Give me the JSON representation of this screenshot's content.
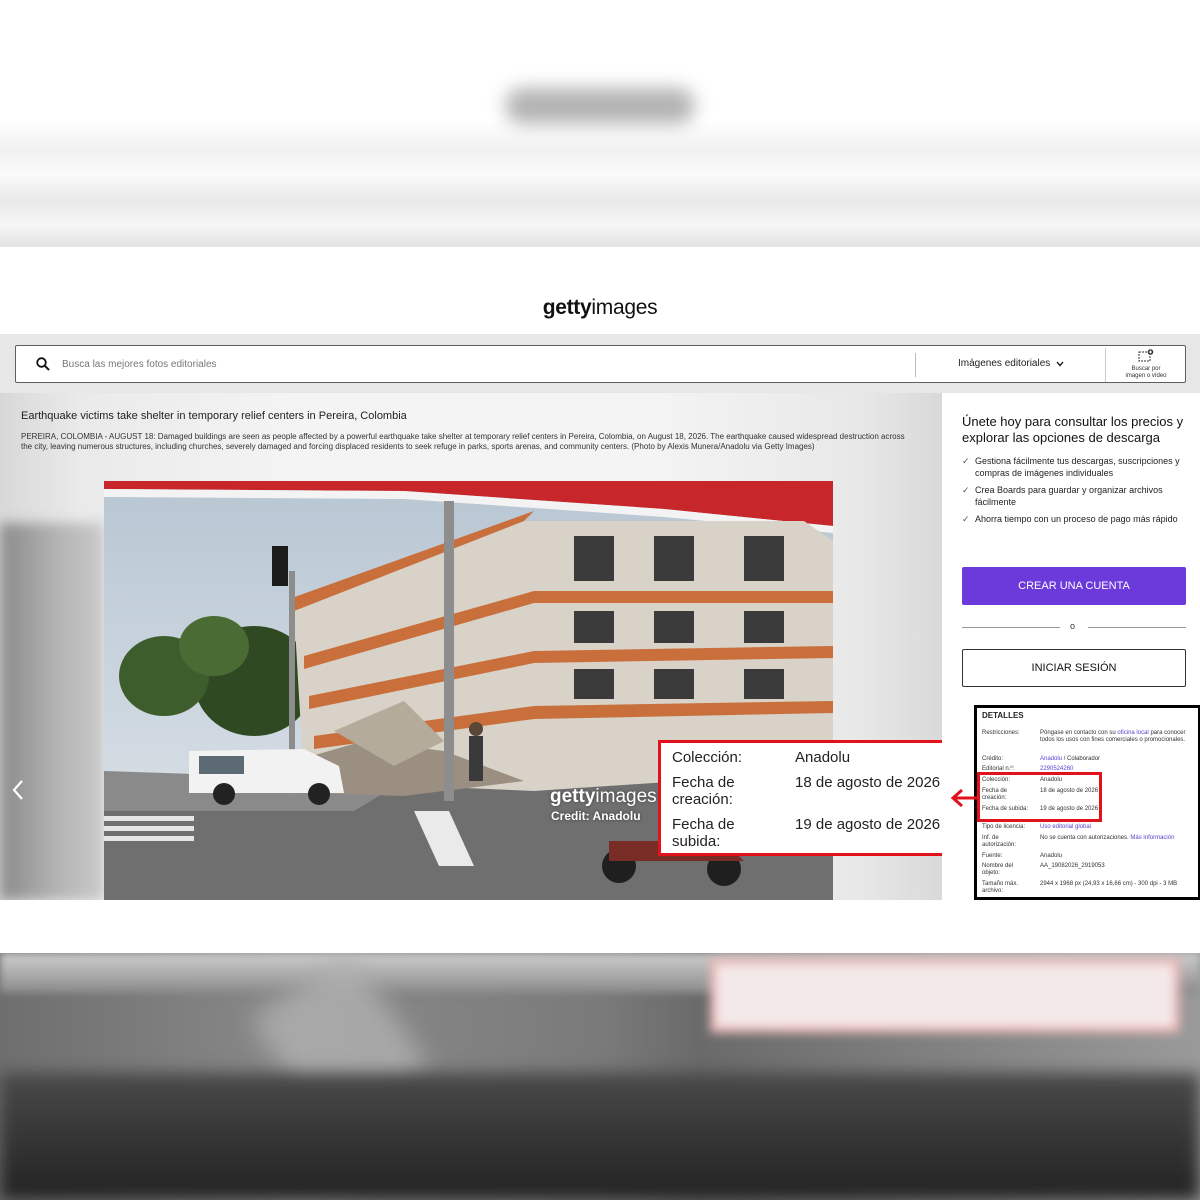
{
  "brand": {
    "logo_bold": "getty",
    "logo_light": "images"
  },
  "search": {
    "placeholder": "Busca las mejores fotos editoriales",
    "type_label": "Imágenes editoriales",
    "visual_search_label_1": "Buscar por",
    "visual_search_label_2": "imagen o vídeo"
  },
  "photo": {
    "title": "Earthquake victims take shelter in temporary relief centers in Pereira, Colombia",
    "caption": "PEREIRA, COLOMBIA - AUGUST 18: Damaged buildings are seen as people affected by a powerful earthquake take shelter at temporary relief centers in Pereira, Colombia, on August 18, 2026. The earthquake caused widespread destruction across the city, leaving numerous structures, including churches, severely damaged and forcing displaced residents to seek refuge in parks, sports arenas, and community centers. (Photo by Alexis Munera/Anadolu via Getty Images)",
    "watermark_bold": "getty",
    "watermark_light": "images",
    "credit": "Credit: Anadolu"
  },
  "highlight": {
    "rows": [
      {
        "label": "Colección:",
        "value": "Anadolu"
      },
      {
        "label": "Fecha de creación:",
        "value": "18 de agosto de 2026"
      },
      {
        "label": "Fecha de subida:",
        "value": "19 de agosto de 2026"
      }
    ]
  },
  "panel": {
    "title": "Únete hoy para consultar los precios y explorar las opciones de descarga",
    "benefits": [
      "Gestiona fácilmente tus descargas, suscripciones y compras de imágenes individuales",
      "Crea Boards para guardar y organizar archivos fácilmente",
      "Ahorra tiempo con un proceso de pago más rápido"
    ],
    "create_account": "CREAR UNA CUENTA",
    "or": "o",
    "login": "INICIAR SESIÓN"
  },
  "details": {
    "title": "DETALLES",
    "restrictions_label": "Restricciones:",
    "restrictions_value_1": "Póngase en contacto con su",
    "restrictions_link": "oficina local",
    "restrictions_value_2": "para conocer todos los usos con fines comerciales o promocionales.",
    "credit_label": "Crédito:",
    "credit_link": "Anadolu",
    "credit_rest": "/ Colaborador",
    "editorial_label": "Editorial n.º:",
    "editorial_value": "2290524260",
    "collection_label": "Colección:",
    "collection_value": "Anadolu",
    "created_label": "Fecha de creación:",
    "created_value": "18 de agosto de 2026",
    "uploaded_label": "Fecha de subida:",
    "uploaded_value": "19 de agosto de 2026",
    "license_label": "Tipo de licencia:",
    "license_value": "Uso editorial global",
    "auth_label": "Inf. de autorización:",
    "auth_value": "No se cuenta con autorizaciones.",
    "auth_link": "Más información",
    "source_label": "Fuente:",
    "source_value": "Anadolu",
    "object_label": "Nombre del objeto:",
    "object_value": "AA_19082026_2919053",
    "size_label": "Tamaño máx. archivo:",
    "size_value": "2944 x 1968 px (24,93 x 16,66 cm) - 300 dpi - 3 MB"
  },
  "colors": {
    "accent": "#6c3adb",
    "highlight_red": "#e1121b",
    "link": "#5b3fd0"
  }
}
